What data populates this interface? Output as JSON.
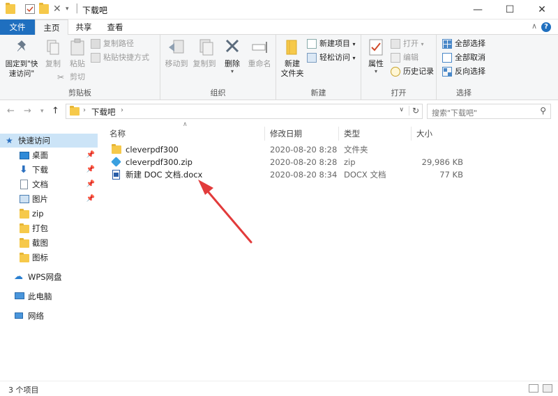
{
  "window": {
    "title": "下载吧"
  },
  "tabs": [
    {
      "label": "文件"
    },
    {
      "label": "主页"
    },
    {
      "label": "共享"
    },
    {
      "label": "查看"
    }
  ],
  "ribbon": {
    "clipboard": {
      "label": "剪贴板",
      "pin": "固定到\"快速访问\"",
      "copy": "复制",
      "paste": "粘贴",
      "copy_path": "复制路径",
      "paste_shortcut": "粘贴快捷方式",
      "cut": "剪切"
    },
    "organize": {
      "label": "组织",
      "move_to": "移动到",
      "copy_to": "复制到",
      "delete": "删除",
      "rename": "重命名"
    },
    "new": {
      "label": "新建",
      "new_folder": "新建\n文件夹",
      "new_item": "新建项目",
      "easy_access": "轻松访问"
    },
    "open": {
      "label": "打开",
      "properties": "属性",
      "open": "打开",
      "edit": "编辑",
      "history": "历史记录"
    },
    "select": {
      "label": "选择",
      "select_all": "全部选择",
      "select_none": "全部取消",
      "invert": "反向选择"
    }
  },
  "address": {
    "path": "下载吧"
  },
  "search": {
    "placeholder": "搜索\"下载吧\""
  },
  "nav": {
    "quick_access": "快速访问",
    "items": [
      {
        "label": "桌面",
        "pinned": true
      },
      {
        "label": "下载",
        "pinned": true
      },
      {
        "label": "文档",
        "pinned": true
      },
      {
        "label": "图片",
        "pinned": true
      },
      {
        "label": "zip",
        "pinned": false
      },
      {
        "label": "打包",
        "pinned": false
      },
      {
        "label": "截图",
        "pinned": false
      },
      {
        "label": "图标",
        "pinned": false
      }
    ],
    "wps": "WPS网盘",
    "this_pc": "此电脑",
    "network": "网络"
  },
  "columns": {
    "name": "名称",
    "date": "修改日期",
    "type": "类型",
    "size": "大小"
  },
  "files": [
    {
      "name": "cleverpdf300",
      "date": "2020-08-20 8:28",
      "type": "文件夹",
      "size": ""
    },
    {
      "name": "cleverpdf300.zip",
      "date": "2020-08-20 8:28",
      "type": "zip",
      "size": "29,986 KB"
    },
    {
      "name": "新建 DOC 文档.docx",
      "date": "2020-08-20 8:34",
      "type": "DOCX 文档",
      "size": "77 KB"
    }
  ],
  "status": {
    "count": "3 个项目"
  },
  "colors": {
    "accent": "#1f6fbf",
    "folder": "#f6c94a",
    "selection": "#cce4f7",
    "arrow": "#e23b3b"
  }
}
